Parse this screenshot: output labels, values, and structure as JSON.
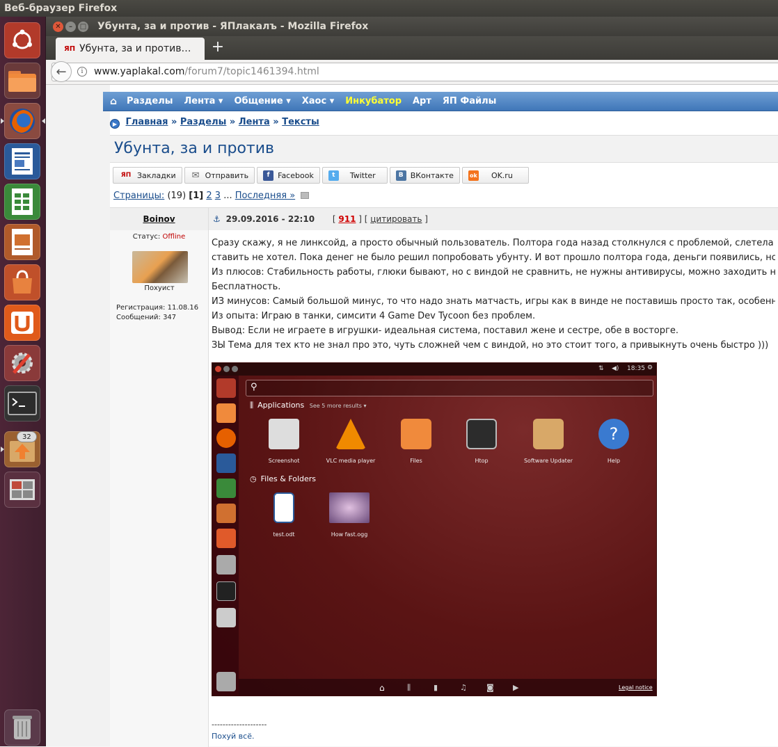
{
  "top_panel": {
    "title": "Веб-браузер Firefox"
  },
  "launcher": {
    "badge": "32"
  },
  "window": {
    "title": "Убунта, за и против - ЯПлакалъ - Mozilla Firefox"
  },
  "tab": {
    "title": "Убунта, за и против…",
    "favicon": "ЯП",
    "new_tab": "+"
  },
  "url": {
    "host": "www.yaplakal.com",
    "path": "/forum7/topic1461394.html"
  },
  "nav": {
    "home": "⌂",
    "items": [
      "Разделы",
      "Лента ▾",
      "Общение ▾",
      "Хаос ▾",
      "Инкубатор",
      "Арт",
      "ЯП Файлы"
    ]
  },
  "breadcrumb": {
    "items": [
      "Главная",
      "Разделы",
      "Лента",
      "Тексты"
    ],
    "sep": "»"
  },
  "topic_title": "Убунта, за и против",
  "share": [
    {
      "icon": "ЯП",
      "label": "Закладки",
      "color": "#c00000"
    },
    {
      "icon": "✉",
      "label": "Отправить",
      "color": "#777777"
    },
    {
      "icon": "f",
      "label": "Facebook",
      "color": "#3b5998"
    },
    {
      "icon": "t",
      "label": "Twitter",
      "color": "#55acee"
    },
    {
      "icon": "В",
      "label": "ВКонтакте",
      "color": "#4c75a3"
    },
    {
      "icon": "ok",
      "label": "OK.ru",
      "color": "#f4731c"
    }
  ],
  "pagination": {
    "label": "Страницы:",
    "count": "(19)",
    "current": "[1]",
    "p2": "2",
    "p3": "3",
    "dots": "...",
    "last": "Последняя »"
  },
  "post": {
    "author": "Boinov",
    "status_label": "Статус:",
    "status": "Offline",
    "rank": "Похуист",
    "reg_label": "Регистрация:",
    "reg": "11.08.16",
    "msgs_label": "Сообщений:",
    "msgs": "347",
    "date": "29.09.2016 - 22:10",
    "rating": "911",
    "quote": "цитировать",
    "lines": [
      "Сразу скажу, я не линксойд, а просто обычный пользователь. Полтора года назад столкнулся с проблемой, слетела в",
      "ставить не хотел. Пока денег не было решил попробовать убунту. И вот прошло полтора года, деньги появились, но в",
      "Из плюсов: Стабильность работы, глюки бывают, но с виндой не сравнить, не нужны антивирусы, можно заходить на",
      "Бесплатность.",
      "ИЗ минусов: Самый большой минус, то что надо знать матчасть, игры как в винде не поставишь просто так, особенно",
      "Из опыта: Играю в танки, симсити 4 Game Dev Tycoon без проблем.",
      "Вывод: Если не играете в игрушки- идеальная система, поставил жене и сестре, обе в восторге.",
      "ЗЫ Тема для тех кто не знал про это, чуть сложней чем с виндой, но это стоит того, а привыкнуть очень быстро )))"
    ],
    "sig_dashes": "--------------------",
    "sig": "Похуй всё."
  },
  "embedded": {
    "time": "18:35",
    "apps_label": "Applications",
    "more": "See 5 more results ▾",
    "apps": [
      "Screenshot",
      "VLC media player",
      "Files",
      "Htop",
      "Software Updater",
      "Help"
    ],
    "files_label": "Files & Folders",
    "files": [
      "test.odt",
      "How fast.ogg"
    ],
    "legal": "Legal notice"
  }
}
